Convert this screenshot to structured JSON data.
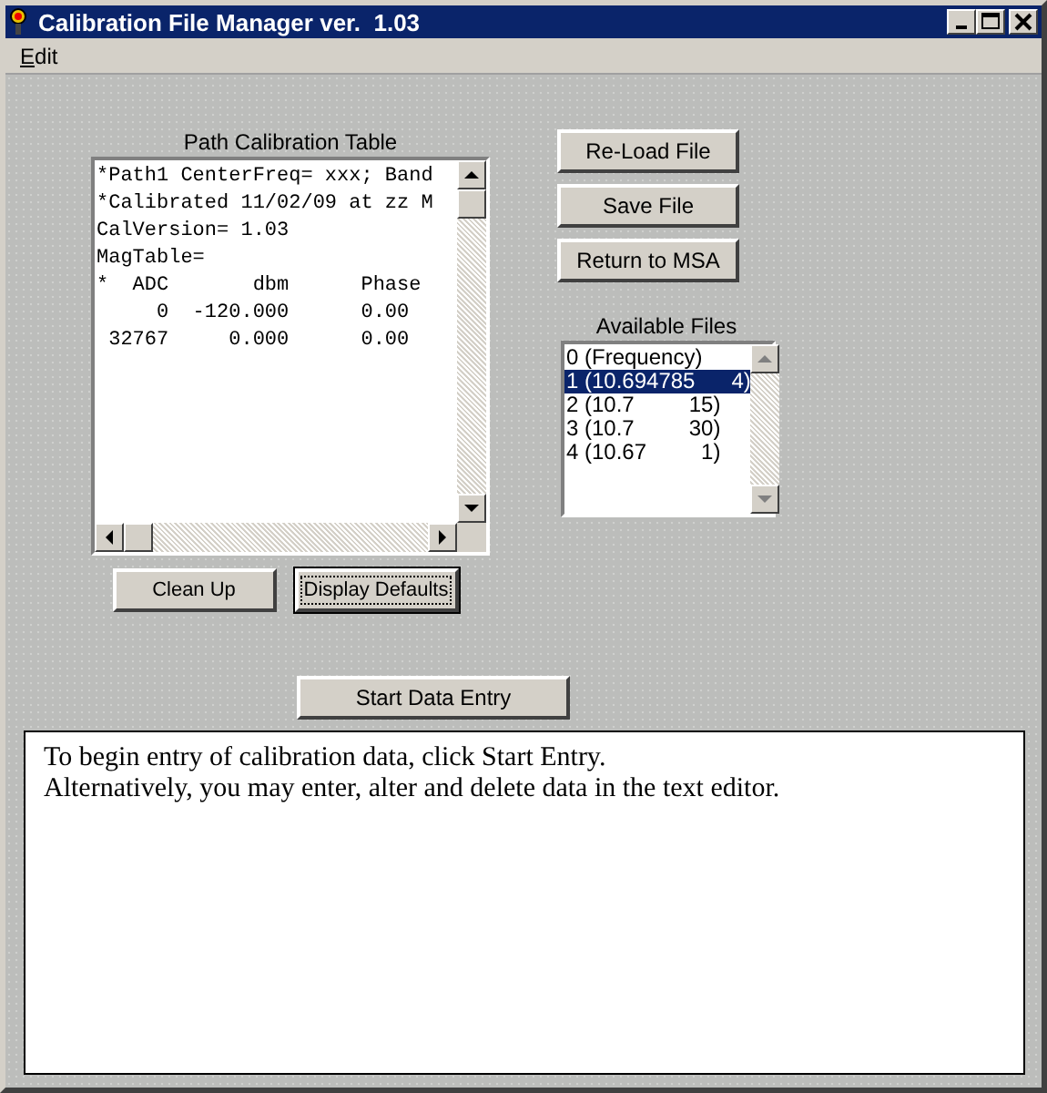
{
  "window": {
    "title": "Calibration File Manager ver.  1.03"
  },
  "menu": [
    {
      "label": "Edit"
    }
  ],
  "calibration_table": {
    "label": "Path Calibration Table",
    "lines": [
      "*Path1 CenterFreq= xxx; Band",
      "*Calibrated 11/02/09 at zz M",
      "CalVersion= 1.03",
      "MagTable=",
      "*  ADC       dbm      Phase",
      "     0  -120.000      0.00",
      " 32767     0.000      0.00"
    ]
  },
  "table_buttons": [
    {
      "label": "Clean Up",
      "focused": false
    },
    {
      "label": "Display Defaults",
      "focused": true
    }
  ],
  "file_buttons": [
    {
      "label": "Re-Load File"
    },
    {
      "label": "Save File"
    },
    {
      "label": "Return to MSA"
    }
  ],
  "available_files": {
    "label": "Available Files",
    "items": [
      {
        "label": "0 (Frequency)",
        "selected": false
      },
      {
        "label": "1 (10.694785      4)",
        "selected": true
      },
      {
        "label": "2 (10.7         15)",
        "selected": false
      },
      {
        "label": "3 (10.7         30)",
        "selected": false
      },
      {
        "label": "4 (10.67         1)",
        "selected": false
      }
    ]
  },
  "start_button": {
    "label": "Start Data Entry"
  },
  "message_lines": [
    "To begin entry of calibration data, click Start Entry.",
    "Alternatively, you may enter, alter and delete data in the text editor."
  ]
}
